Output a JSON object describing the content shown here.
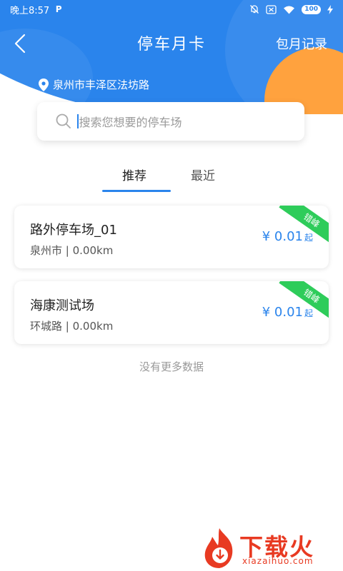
{
  "status_bar": {
    "time": "晚上8:57",
    "app_indicator": "P",
    "battery": "100",
    "icons": [
      "mute-bell-icon",
      "sim-off-icon",
      "wifi-icon",
      "battery-icon",
      "charging-icon"
    ]
  },
  "nav": {
    "title": "停车月卡",
    "right_link": "包月记录",
    "back_icon": "chevron-left-icon"
  },
  "location": {
    "icon": "location-pin-icon",
    "text": "泉州市丰泽区法坊路"
  },
  "search": {
    "icon": "search-icon",
    "placeholder": "搜索您想要的停车场"
  },
  "tabs": [
    {
      "label": "推荐",
      "active": true
    },
    {
      "label": "最近",
      "active": false
    }
  ],
  "parking_lots": [
    {
      "name": "路外停车场_01",
      "area": "泉州市",
      "distance": "0.00km",
      "price": "¥ 0.01",
      "price_suffix": "起",
      "badge": "错峰"
    },
    {
      "name": "海康测试场",
      "area": "环城路",
      "distance": "0.00km",
      "price": "¥ 0.01",
      "price_suffix": "起",
      "badge": "错峰"
    }
  ],
  "list_footer": "没有更多数据",
  "watermark": {
    "brand": "下载火",
    "url": "xiazaihuo.com"
  },
  "colors": {
    "primary": "#2a84ec",
    "accent_orange": "#ffa23e",
    "badge_green": "#2ecc5a",
    "watermark_red": "#e83a22"
  }
}
